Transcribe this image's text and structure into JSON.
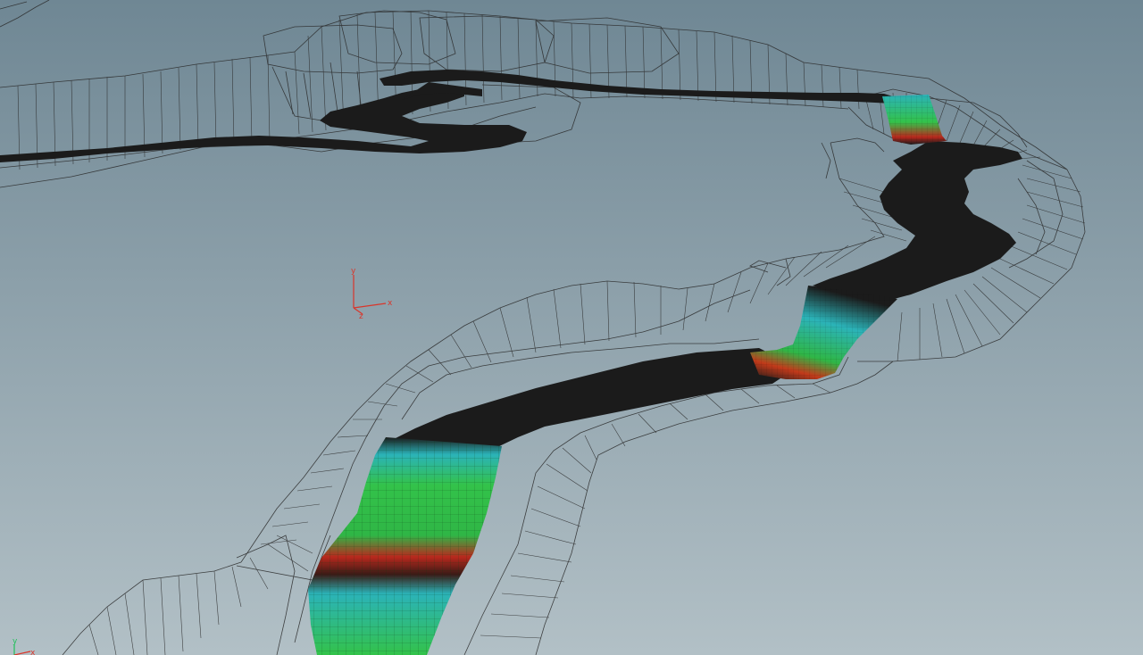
{
  "viewport": {
    "background_top": "#6f8794",
    "background_bottom": "#b2c0c6",
    "wire_color": "#2b2b2b",
    "surface_color": "#1b1b1b"
  },
  "gizmo": {
    "y_label": "y",
    "x_label": "x",
    "z_label": "z",
    "color": "#d9362b"
  },
  "corner_gizmo": {
    "y_label": "y",
    "x_label": "x",
    "y_color": "#21c05a",
    "x_color": "#d9362b"
  },
  "attribute_ramp": {
    "colors": [
      "#1b1b1b",
      "#2bb3b8",
      "#33c24a",
      "#b8281d",
      "#1b1b1b"
    ]
  }
}
